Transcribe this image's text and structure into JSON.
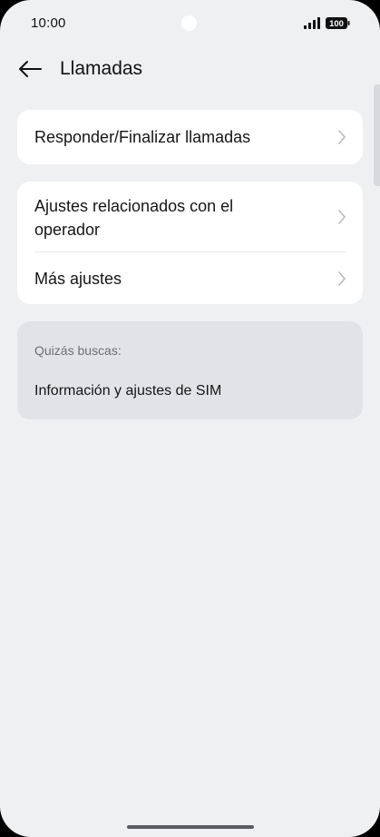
{
  "status": {
    "time": "10:00",
    "battery": "100",
    "icons": [
      "signal-icon",
      "battery-icon"
    ]
  },
  "header": {
    "title": "Llamadas",
    "back_icon": "back-arrow-icon"
  },
  "card1": {
    "items": [
      {
        "label": "Responder/Finalizar llamadas",
        "icon": "chevron-right-icon"
      }
    ]
  },
  "card2": {
    "items": [
      {
        "label": "Ajustes relacionados con el operador",
        "icon": "chevron-right-icon"
      },
      {
        "label": "Más ajustes",
        "icon": "chevron-right-icon"
      }
    ]
  },
  "suggestions": {
    "label": "Quizás buscas:",
    "items": [
      "Información y ajustes de SIM"
    ]
  },
  "colors": {
    "background": "#eff0f2",
    "card": "#ffffff",
    "suggest_bg": "#e2e3e6",
    "text": "#161616",
    "muted": "#6e6f73",
    "chevron": "#b8b9bd"
  }
}
